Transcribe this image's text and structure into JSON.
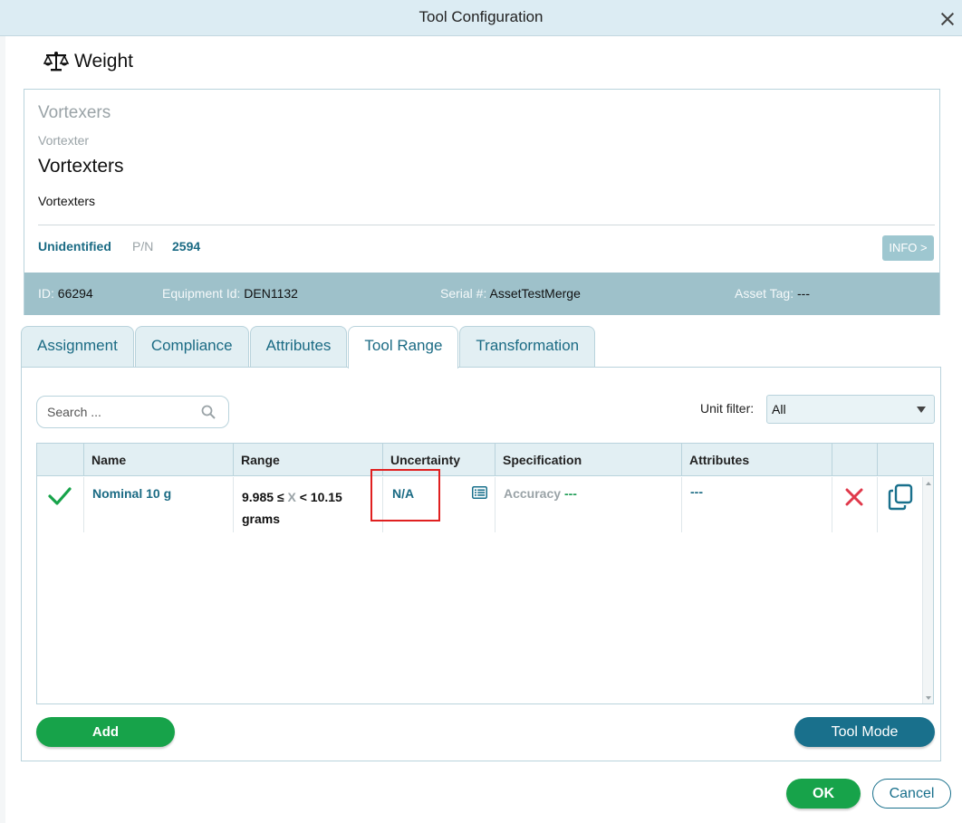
{
  "window": {
    "title": "Tool Configuration"
  },
  "heading": {
    "icon": "balance-scale-icon",
    "title": "Weight"
  },
  "asset": {
    "type": "Vortexers",
    "subtype": "Vortexter",
    "name": "Vortexters",
    "description": "Vortexters",
    "status": "Unidentified",
    "pn_label": "P/N",
    "pn_value": "2594",
    "info_button": "INFO >",
    "id_label": "ID:",
    "id_value": "66294",
    "equipment_label": "Equipment Id:",
    "equipment_value": "DEN1132",
    "serial_label": "Serial #:",
    "serial_value": "AssetTestMerge",
    "asset_tag_label": "Asset Tag:",
    "asset_tag_value": "---"
  },
  "tabs": [
    {
      "label": "Assignment",
      "active": false
    },
    {
      "label": "Compliance",
      "active": false
    },
    {
      "label": "Attributes",
      "active": false
    },
    {
      "label": "Tool Range",
      "active": true
    },
    {
      "label": "Transformation",
      "active": false
    }
  ],
  "search": {
    "placeholder": "Search ...",
    "value": ""
  },
  "unit_filter": {
    "label": "Unit filter:",
    "value": "All"
  },
  "table": {
    "columns": [
      "",
      "Name",
      "Range",
      "Uncertainty",
      "Specification",
      "Attributes",
      "",
      ""
    ],
    "rows": [
      {
        "status_icon": "checkmark-icon",
        "name": "Nominal 10 g",
        "range_lower": "9.985 ≤",
        "range_var": "X",
        "range_upper": "< 10.15",
        "range_unit": "grams",
        "uncertainty": "N/A",
        "specification_label": "Accuracy",
        "specification_value": "---",
        "attributes": "---"
      }
    ]
  },
  "buttons": {
    "add": "Add",
    "tool_mode": "Tool Mode",
    "ok": "OK",
    "cancel": "Cancel"
  },
  "colors": {
    "accent": "#19708c",
    "success": "#17a34a",
    "danger": "#e0384a",
    "header_bg": "#dcecf3",
    "bar_bg": "#9ec1ca"
  }
}
